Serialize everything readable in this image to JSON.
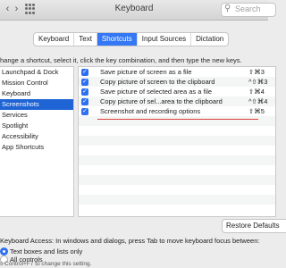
{
  "window": {
    "title": "Keyboard",
    "search_placeholder": "Search",
    "back_glyph": "‹",
    "forward_glyph": "›"
  },
  "tabs": [
    {
      "label": "Keyboard",
      "active": false
    },
    {
      "label": "Text",
      "active": false
    },
    {
      "label": "Shortcuts",
      "active": true
    },
    {
      "label": "Input Sources",
      "active": false
    },
    {
      "label": "Dictation",
      "active": false
    }
  ],
  "instruction": "hange a shortcut, select it, click the key combination, and then type the new keys.",
  "categories": [
    {
      "label": "Launchpad & Dock",
      "selected": false
    },
    {
      "label": "Mission Control",
      "selected": false
    },
    {
      "label": "Keyboard",
      "selected": false
    },
    {
      "label": "Screenshots",
      "selected": true
    },
    {
      "label": "Services",
      "selected": false
    },
    {
      "label": "Spotlight",
      "selected": false
    },
    {
      "label": "Accessibility",
      "selected": false
    },
    {
      "label": "App Shortcuts",
      "selected": false
    }
  ],
  "shortcuts": [
    {
      "checked": true,
      "label": "Save picture of screen as a file",
      "keys": "⇧⌘3"
    },
    {
      "checked": true,
      "label": "Copy picture of screen to the clipboard",
      "keys": "^⇧⌘3"
    },
    {
      "checked": true,
      "label": "Save picture of selected area as a file",
      "keys": "⇧⌘4"
    },
    {
      "checked": true,
      "label": "Copy picture of sel...area to the clipboard",
      "keys": "^⇧⌘4"
    },
    {
      "checked": true,
      "label": "Screenshot and recording options",
      "keys": "⇧⌘5"
    }
  ],
  "restore_button": "Restore Defaults",
  "keyboard_access": {
    "text": "Keyboard Access: In windows and dialogs, press Tab to move keyboard focus between:",
    "options": [
      {
        "label": "Text boxes and lists only",
        "selected": true
      },
      {
        "label": "All controls",
        "selected": false
      }
    ],
    "hint": "s Control+F7 to change this setting."
  },
  "colors": {
    "accent": "#3478f6",
    "selection": "#1f64d4",
    "annotation_line": "#e0433b"
  }
}
